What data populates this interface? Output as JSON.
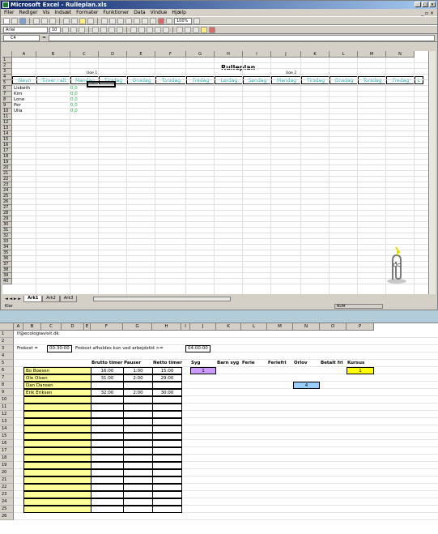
{
  "window": {
    "title": "Microsoft Excel - Rulleplan.xls"
  },
  "menu": [
    "Filer",
    "Rediger",
    "Vis",
    "Indsæt",
    "Formater",
    "Funktioner",
    "Data",
    "Vindue",
    "Hjælp"
  ],
  "toolbar": {
    "zoom": "100%",
    "font": "Arial",
    "size": "10"
  },
  "formula": {
    "cell_ref": "C4",
    "fx": "="
  },
  "sheet1": {
    "title": "Rulleplan",
    "week1": "Uge 1",
    "week2": "Uge 2",
    "columns": [
      "A",
      "B",
      "C",
      "D",
      "E",
      "F",
      "G",
      "H",
      "I",
      "J",
      "K",
      "L",
      "M",
      "N"
    ],
    "header": [
      "Navn",
      "Timer i alt",
      "Mandag",
      "Tirsdag",
      "Onsdag",
      "Torsdag",
      "Fredag",
      "Lørdag",
      "Søndag",
      "Mandag",
      "Tirsdag",
      "Onsdag",
      "Torsdag",
      "Fredag",
      "L"
    ],
    "names": [
      "Lisbeth",
      "Kim",
      "Lone",
      "Per",
      "Ulla"
    ],
    "values": [
      "0,0",
      "0,0",
      "0,0",
      "0,0",
      "0,0"
    ],
    "rows": [
      "1",
      "2",
      "3",
      "4",
      "5",
      "6",
      "7",
      "8",
      "9",
      "10",
      "11",
      "12",
      "13",
      "14",
      "15",
      "16",
      "17",
      "18",
      "19",
      "20",
      "21",
      "22",
      "23",
      "24",
      "25",
      "26",
      "27",
      "28",
      "29",
      "30",
      "31",
      "32",
      "33",
      "34",
      "35",
      "36",
      "37",
      "38",
      "39",
      "40"
    ]
  },
  "tabs": [
    "Ark1",
    "Ark2",
    "Ark3"
  ],
  "status": {
    "left": "Klar",
    "mode": "NUM"
  },
  "sheet2": {
    "columns": [
      "A",
      "B",
      "C",
      "D",
      "E",
      "F",
      "G",
      "H",
      "I",
      "J",
      "K",
      "L",
      "M",
      "N",
      "O",
      "P"
    ],
    "email": "lf@ecologiavisit.dk",
    "frokost_label": "Frokost =",
    "frokost_value": "00:30:00",
    "frokost_note": "Frokost afholdes kun ved arbejdstid >=",
    "frokost_min": "04:00:00",
    "headers": [
      "Brutto timer",
      "Pauser",
      "Netto timer",
      "Syg",
      "Barn syg",
      "Ferie",
      "Feriefri",
      "Orlov",
      "Betalt fri",
      "Kursus"
    ],
    "employees": [
      {
        "name": "Bo Boesen",
        "brutto": "16:00",
        "pauser": "1:00",
        "netto": "15:00"
      },
      {
        "name": "Ole Olsen",
        "brutto": "31:00",
        "pauser": "2:00",
        "netto": "29:00"
      },
      {
        "name": "Dan Dansen",
        "brutto": "",
        "pauser": "",
        "netto": ""
      },
      {
        "name": "Erik Eriksen",
        "brutto": "32:00",
        "pauser": "2:00",
        "netto": "30:00"
      }
    ],
    "syg_value": "1",
    "kursus_value": "1",
    "orlov_value": "4",
    "rows": [
      "1",
      "2",
      "3",
      "4",
      "5",
      "6",
      "7",
      "8",
      "9",
      "10",
      "11",
      "12",
      "13",
      "14",
      "15",
      "16",
      "17",
      "18",
      "19",
      "20",
      "21",
      "22",
      "23",
      "24",
      "25",
      "26"
    ]
  },
  "colors": {
    "purple": "#cc99ff",
    "yellow": "#ffff00",
    "blue": "#99ccff",
    "namefill": "#ffff99",
    "teal": "#12a6a6"
  }
}
